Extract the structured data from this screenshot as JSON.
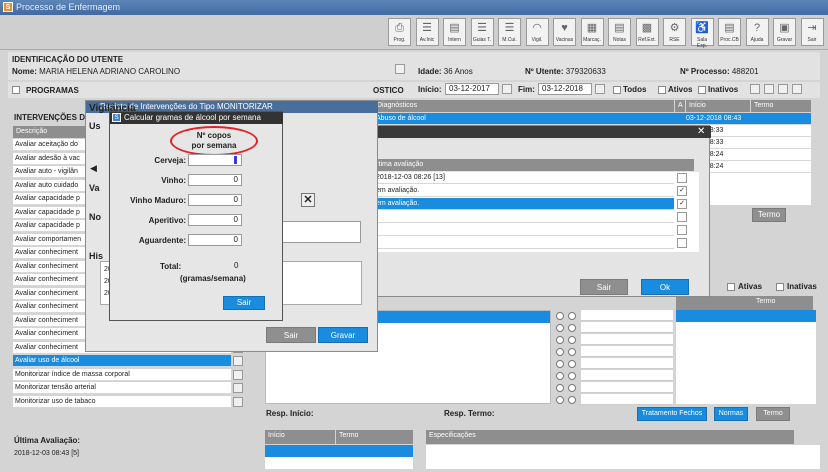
{
  "window": {
    "title": "Processo de Enfermagem",
    "app_icon": "S"
  },
  "toolbar": {
    "buttons": [
      {
        "label": "Prog.",
        "icon": "printer-icon"
      },
      {
        "label": "Av.Inic",
        "icon": "list-icon"
      },
      {
        "label": "Intern",
        "icon": "doc-icon"
      },
      {
        "label": "Guias T.",
        "icon": "list-icon"
      },
      {
        "label": "M.Cui.",
        "icon": "list-icon"
      },
      {
        "label": "Vigil.",
        "icon": "wifi-icon"
      },
      {
        "label": "Vacinas",
        "icon": "heart-icon"
      },
      {
        "label": "Marcaç.",
        "icon": "calendar-icon"
      },
      {
        "label": "Notas",
        "icon": "doc-icon"
      },
      {
        "label": "Ref.Ext.",
        "icon": "grid-icon"
      },
      {
        "label": "RSE",
        "icon": "gear-icon"
      },
      {
        "label": "Sala Esp.",
        "icon": "person-icon"
      },
      {
        "label": "Proc.CB",
        "icon": "doc-icon"
      },
      {
        "label": "Ajuda",
        "icon": "question-icon"
      },
      {
        "label": "Gravar",
        "icon": "save-icon"
      },
      {
        "label": "Sair",
        "icon": "exit-icon"
      }
    ]
  },
  "patient": {
    "section_title": "IDENTIFICAÇÃO DO UTENTE",
    "name_label": "Nome:",
    "name": "MARIA HELENA ADRIANO CAROLINO",
    "age_label": "Idade:",
    "age": "36 Anos",
    "utente_label": "Nº Utente:",
    "utente": "379320633",
    "processo_label": "Nº Processo:",
    "processo": "488201"
  },
  "programs": {
    "label": "PROGRAMAS",
    "diag_header": "OSTICO",
    "inicio_label": "Início:",
    "inicio": "03-12-2017",
    "fim_label": "Fim:",
    "fim": "03-12-2018",
    "todos": "Todos",
    "ativos": "Ativos",
    "inativos": "Inativos"
  },
  "diagnosticos": {
    "col_diag": "Diagnósticos",
    "col_a": "A",
    "col_inicio": "Início",
    "col_termo": "Termo",
    "rows": [
      {
        "diag": "Abuso de álcool",
        "inicio": "03-12-2018 08:43"
      },
      {
        "diag": "",
        "inicio": "-2018 08:33"
      },
      {
        "diag": "",
        "inicio": "-2018 08:33"
      },
      {
        "diag": "",
        "inicio": "-2018 08:24"
      },
      {
        "diag": "",
        "inicio": "-2018 08:24"
      }
    ],
    "termo_button": "Termo"
  },
  "interventions": {
    "title": "INTERVENÇÕES DE",
    "col_descricao": "Descrição",
    "rows": [
      "Avaliar aceitação do",
      "Avaliar adesão à vac",
      "Avaliar auto - vigilân",
      "Avaliar auto cuidado",
      "Avaliar capacidade p",
      "Avaliar capacidade p",
      "Avaliar capacidade p",
      "Avaliar comportamen",
      "Avaliar conheciment",
      "Avaliar conheciment",
      "Avaliar conheciment",
      "Avaliar conheciment",
      "Avaliar conheciment",
      "Avaliar conheciment",
      "Avaliar conheciment",
      "Avaliar conheciment",
      "Avaliar uso de álcool",
      "Monitorizar índice de massa corporal",
      "Monitorizar tensão arterial",
      "Monitorizar uso de tabaco"
    ],
    "selected_index": 16,
    "last_eval_label": "Última Avaliação:",
    "last_eval": "2018-12-03 08:43 [5]"
  },
  "resp": {
    "inicio_label": "Resp. Início:",
    "termo_label": "Resp. Termo:",
    "tratamento_btn": "Tratamento Fechos",
    "normas_btn": "Normas",
    "termo_btn": "Termo",
    "ativas": "Ativas",
    "inativas": "Inativas",
    "termo_col": "Termo"
  },
  "bottom_grid": {
    "inicio": "Início",
    "termo": "Termo",
    "especificacoes": "Especificações"
  },
  "registo_dialog": {
    "title": "Registo de Intervenções do Tipo MONITORIZAR",
    "vigilancia": "Vigilância",
    "section_u": "Us",
    "section_va": "Va",
    "section_no": "No",
    "section_hi": "His",
    "history": [
      "20",
      "20",
      "20"
    ],
    "sair": "Sair",
    "gravar": "Gravar"
  },
  "avaliacao_dialog": {
    "col_title": "ltima avaliação",
    "rows": [
      {
        "text": "2018-12-03 08:26 [13]",
        "checked": false
      },
      {
        "text": "em avaliação.",
        "checked": true
      },
      {
        "text": "em avaliação.",
        "checked": true,
        "selected": true
      },
      {
        "text": "",
        "checked": false
      },
      {
        "text": "",
        "checked": false
      },
      {
        "text": "",
        "checked": false
      }
    ],
    "sair": "Sair",
    "ok": "Ok"
  },
  "alcohol_dialog": {
    "title": "Calcular gramas de álcool por semana",
    "header_line1": "Nº copos",
    "header_line2": "por semana",
    "fields": [
      {
        "label": "Cerveja:",
        "value": ""
      },
      {
        "label": "Vinho:",
        "value": "0"
      },
      {
        "label": "Vinho Maduro:",
        "value": "0"
      },
      {
        "label": "Aperitivo:",
        "value": "0"
      },
      {
        "label": "Aguardente:",
        "value": "0"
      }
    ],
    "total_label": "Total:",
    "total_value": "0",
    "total_unit": "(gramas/semana)",
    "sair": "Sair",
    "highlight_color": "#e0232a"
  }
}
